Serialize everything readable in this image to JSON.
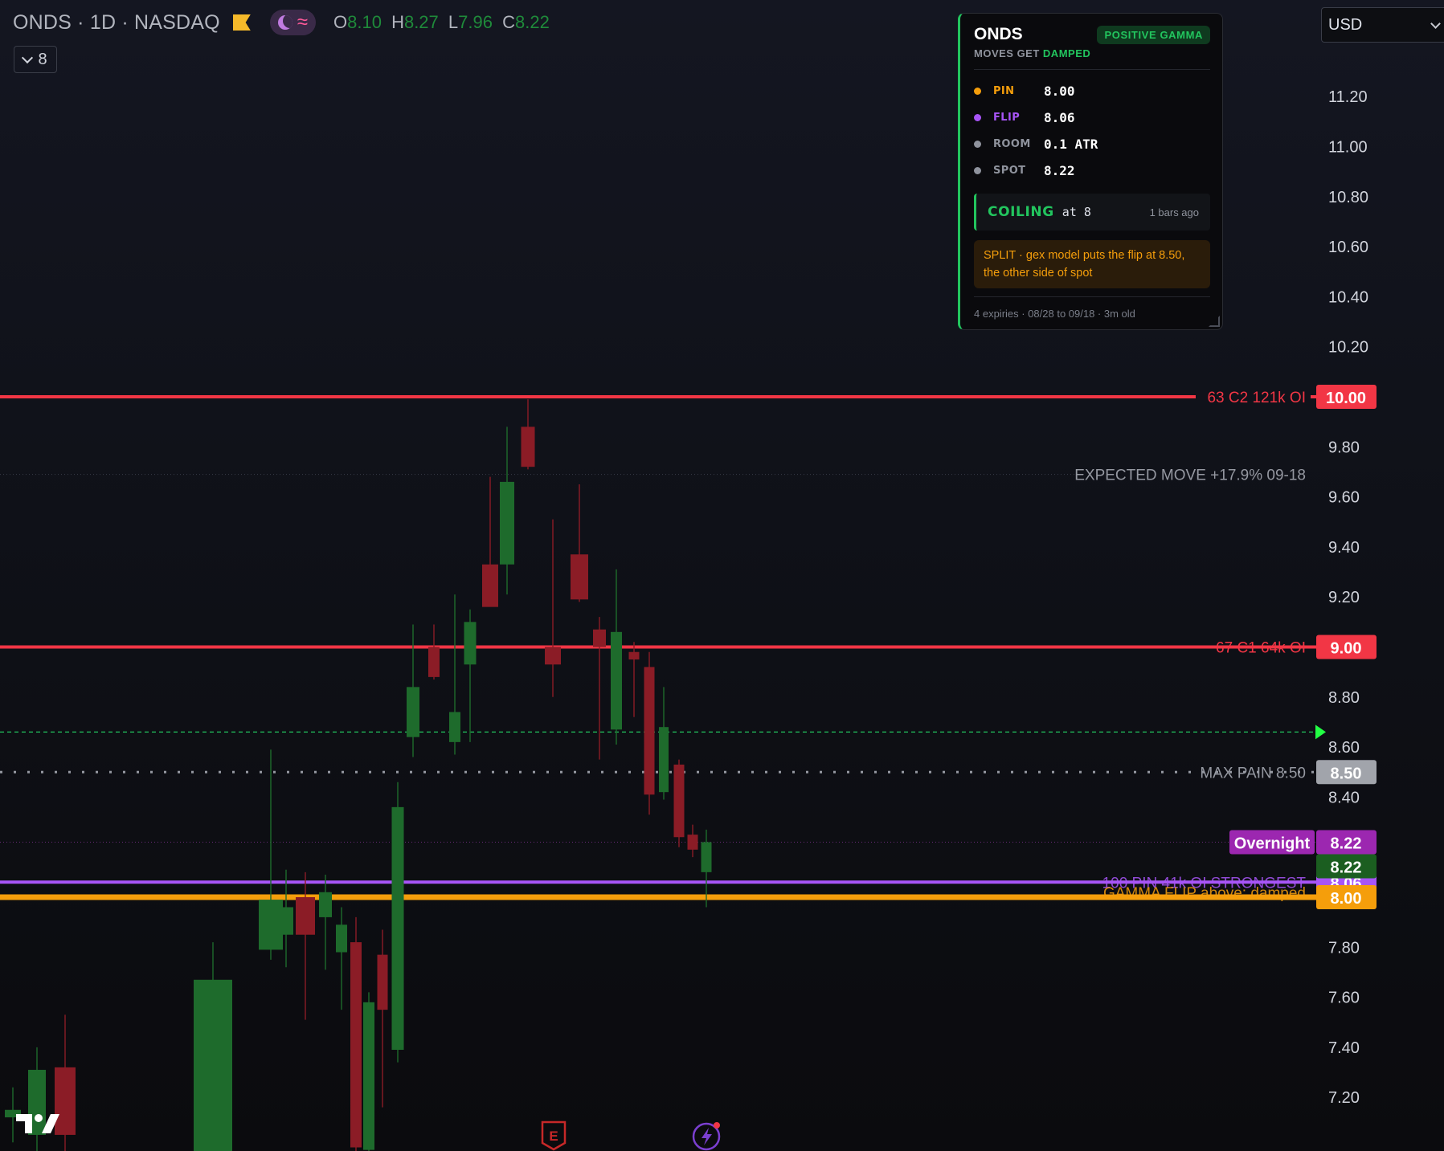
{
  "header": {
    "title": "ONDS · 1D · NASDAQ",
    "ohlc": {
      "o": "8.10",
      "h": "8.27",
      "l": "7.96",
      "c": "8.22"
    },
    "indicators_count": "8"
  },
  "currency": {
    "selected": "USD"
  },
  "panel": {
    "ticker": "ONDS",
    "badge": "POSITIVE GAMMA",
    "subtitle_prefix": "MOVES GET",
    "subtitle_state": "DAMPED",
    "rows": [
      {
        "label": "PIN",
        "value": "8.00",
        "color": "#f59e0b"
      },
      {
        "label": "FLIP",
        "value": "8.06",
        "color": "#a855f7"
      },
      {
        "label": "ROOM",
        "value": "0.1 ATR",
        "color": "#8f939d"
      },
      {
        "label": "SPOT",
        "value": "8.22",
        "color": "#8f939d"
      }
    ],
    "coil_word": "COILING",
    "coil_at": "at 8",
    "coil_ago": "1 bars ago",
    "split_note": "SPLIT · gex model puts the flip at 8.50, the other side of spot",
    "footer": "4 expiries · 08/28 to 09/18 · 3m old"
  },
  "chart_data": {
    "type": "candlestick",
    "symbol": "ONDS",
    "interval": "1D",
    "exchange": "NASDAQ",
    "y_range": [
      7.05,
      11.45
    ],
    "y_ticks": [
      "11.20",
      "11.00",
      "10.80",
      "10.60",
      "10.40",
      "10.20",
      "9.80",
      "9.60",
      "9.40",
      "9.20",
      "8.80",
      "8.60",
      "8.40",
      "7.80",
      "7.60",
      "7.40",
      "7.20"
    ],
    "candles": [
      {
        "o": 7.12,
        "h": 7.24,
        "l": 7.02,
        "c": 7.15
      },
      {
        "o": 7.05,
        "h": 7.4,
        "l": 6.95,
        "c": 7.31
      },
      {
        "o": 7.32,
        "h": 7.53,
        "l": 6.98,
        "c": 7.05
      },
      {
        "o": 6.9,
        "h": 7.0,
        "l": 6.8,
        "c": 6.92
      },
      {
        "o": 6.95,
        "h": 7.82,
        "l": 6.9,
        "c": 7.67
      },
      {
        "o": 7.79,
        "h": 8.59,
        "l": 7.75,
        "c": 7.99
      },
      {
        "o": 7.85,
        "h": 8.11,
        "l": 7.72,
        "c": 7.96
      },
      {
        "o": 8.0,
        "h": 8.1,
        "l": 7.51,
        "c": 7.85
      },
      {
        "o": 7.92,
        "h": 8.09,
        "l": 7.71,
        "c": 8.02
      },
      {
        "o": 7.78,
        "h": 7.96,
        "l": 7.55,
        "c": 7.89
      },
      {
        "o": 7.82,
        "h": 7.92,
        "l": 6.8,
        "c": 7.0
      },
      {
        "o": 6.99,
        "h": 7.62,
        "l": 6.94,
        "c": 7.58
      },
      {
        "o": 7.77,
        "h": 7.87,
        "l": 7.16,
        "c": 7.55
      },
      {
        "o": 7.39,
        "h": 8.46,
        "l": 7.34,
        "c": 8.36
      },
      {
        "o": 8.64,
        "h": 9.09,
        "l": 8.56,
        "c": 8.84
      },
      {
        "o": 9.0,
        "h": 9.09,
        "l": 8.87,
        "c": 8.88
      },
      {
        "o": 8.62,
        "h": 9.21,
        "l": 8.57,
        "c": 8.74
      },
      {
        "o": 8.93,
        "h": 9.15,
        "l": 8.62,
        "c": 9.1
      },
      {
        "o": 9.33,
        "h": 9.68,
        "l": 9.18,
        "c": 9.16
      },
      {
        "o": 9.33,
        "h": 9.88,
        "l": 9.21,
        "c": 9.66
      },
      {
        "o": 9.88,
        "h": 9.99,
        "l": 9.71,
        "c": 9.72
      },
      {
        "o": 9.0,
        "h": 9.51,
        "l": 8.8,
        "c": 8.93
      },
      {
        "o": 9.37,
        "h": 9.65,
        "l": 9.18,
        "c": 9.19
      },
      {
        "o": 9.07,
        "h": 9.12,
        "l": 8.55,
        "c": 9.0
      },
      {
        "o": 8.67,
        "h": 9.31,
        "l": 8.61,
        "c": 9.06
      },
      {
        "o": 8.98,
        "h": 9.02,
        "l": 8.72,
        "c": 8.95
      },
      {
        "o": 8.92,
        "h": 8.98,
        "l": 8.33,
        "c": 8.41
      },
      {
        "o": 8.42,
        "h": 8.84,
        "l": 8.39,
        "c": 8.68
      },
      {
        "o": 8.53,
        "h": 8.55,
        "l": 8.2,
        "c": 8.24
      },
      {
        "o": 8.25,
        "h": 8.29,
        "l": 8.16,
        "c": 8.19
      },
      {
        "o": 8.1,
        "h": 8.27,
        "l": 7.96,
        "c": 8.22
      }
    ],
    "levels": [
      {
        "price": 10.0,
        "label": "63  C2  121k OI",
        "tag": "10.00",
        "color": "#f23645",
        "style": "solid"
      },
      {
        "price": 9.0,
        "label": "67  C1  64k OI",
        "tag": "9.00",
        "color": "#f23645",
        "style": "solid"
      },
      {
        "price": 8.66,
        "label": "",
        "tag": "",
        "color": "#22c55e",
        "style": "dashed"
      },
      {
        "price": 8.5,
        "label": "MAX PAIN  8.50",
        "tag": "8.50",
        "color": "#9598a1",
        "style": "dotted"
      },
      {
        "price": 8.06,
        "label": "100  PIN  41k OI  STRONGEST",
        "tag": "8.06",
        "color": "#a855f7",
        "style": "solid"
      },
      {
        "price": 8.0,
        "label": "GAMMA FLIP  above: damped",
        "tag": "8.00",
        "color": "#f59e0b",
        "style": "solid"
      }
    ],
    "expected_move": {
      "price": 9.69,
      "label": "EXPECTED MOVE  +17.9% 09-18"
    },
    "overnight": {
      "price": 8.22,
      "label": "Overnight",
      "tag": "8.22",
      "color": "#9c27b0"
    },
    "last_price": {
      "price": 8.22,
      "tag": "8.22",
      "color": "#1b5e20"
    }
  }
}
